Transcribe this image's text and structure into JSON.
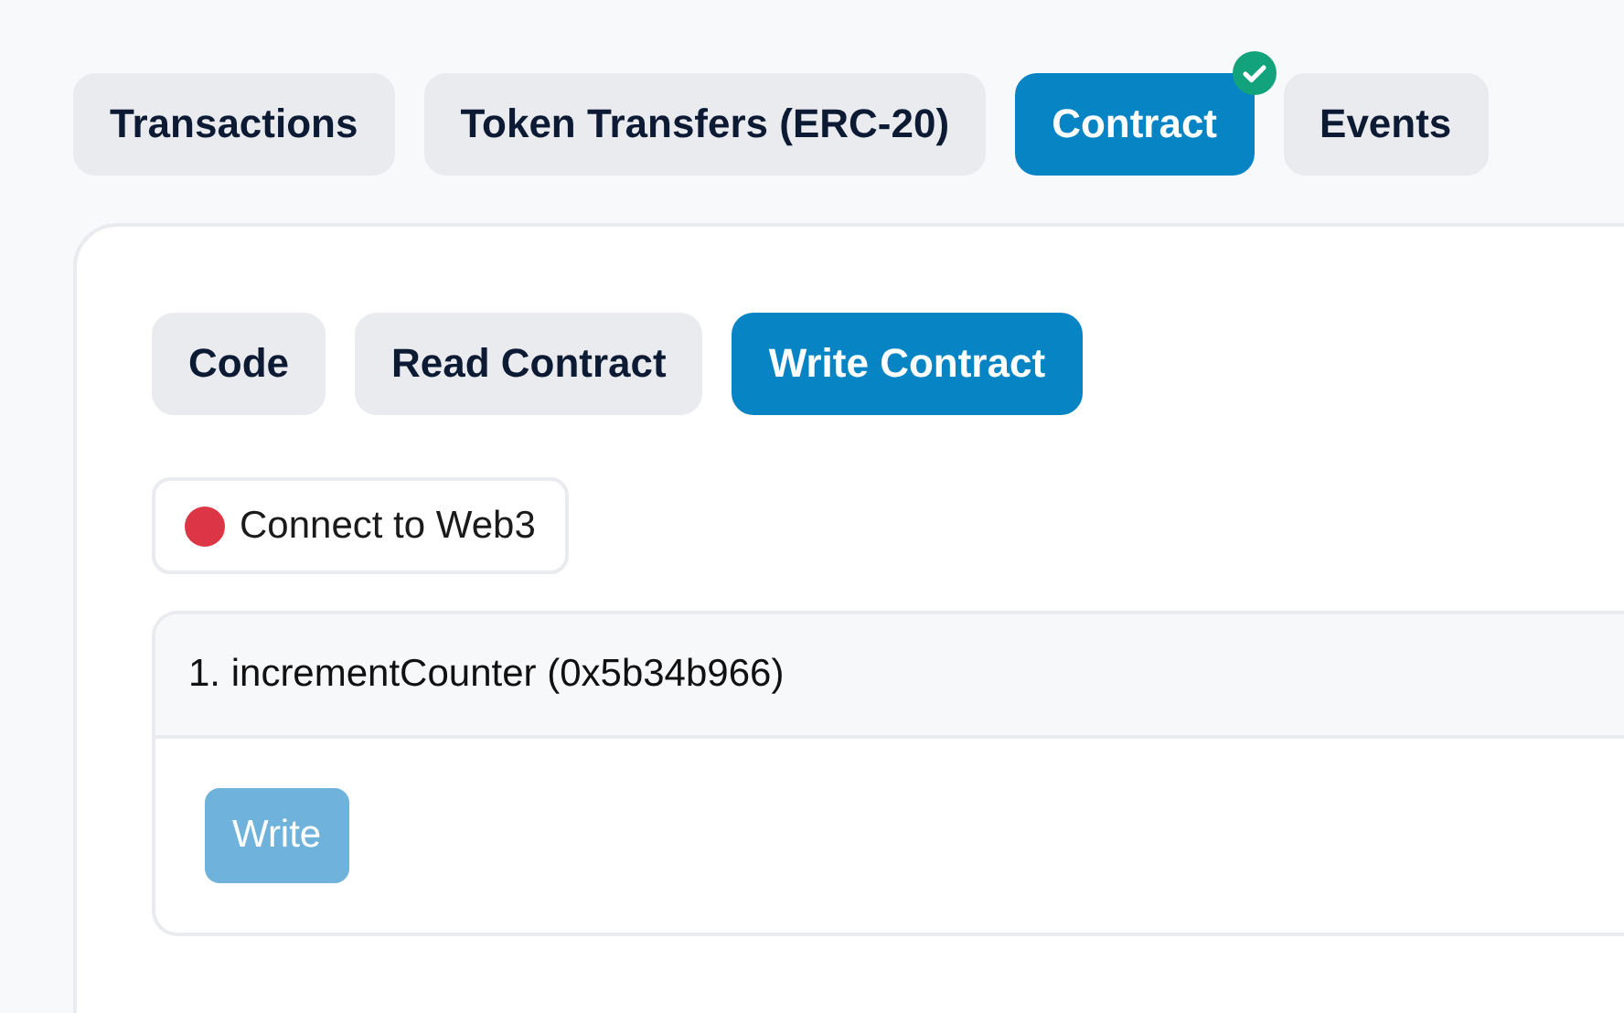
{
  "tabs": [
    {
      "label": "Transactions",
      "selected": false,
      "verified": false
    },
    {
      "label": "Token Transfers (ERC-20)",
      "selected": false,
      "verified": false
    },
    {
      "label": "Contract",
      "selected": true,
      "verified": true
    },
    {
      "label": "Events",
      "selected": false,
      "verified": false
    }
  ],
  "subtabs": [
    {
      "label": "Code",
      "selected": false
    },
    {
      "label": "Read Contract",
      "selected": false
    },
    {
      "label": "Write Contract",
      "selected": true
    }
  ],
  "connect_button": {
    "label": "Connect to Web3",
    "color": "#dc3545"
  },
  "functions": [
    {
      "title": "1. incrementCounter (0x5b34b966)",
      "button": {
        "label": "Write",
        "disabled": true
      }
    }
  ]
}
